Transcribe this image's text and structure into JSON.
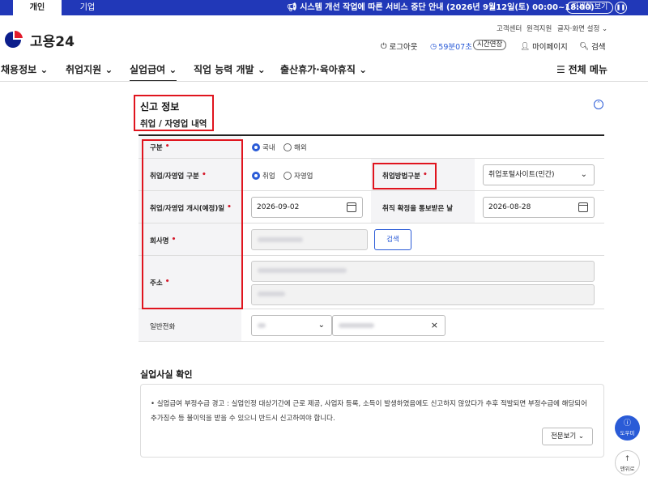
{
  "top_tabs": [
    "개인",
    "기업"
  ],
  "notice_bar": {
    "text": "시스템 개선 작업에 따른 서비스 중단 안내 (2026년 9월12일(토) 00:00~18:00)",
    "detail_button": "자세히 보기",
    "pause_icon": "pause-icon"
  },
  "utility_links": [
    "고객센터",
    "원격지원",
    "글자·화면 설정"
  ],
  "logo": {
    "text": "고용24"
  },
  "account": {
    "logout": "로그아웃",
    "timer": "59분07초",
    "extend": "시간연장",
    "mypage": "마이페이지",
    "search": "검색"
  },
  "gnb": {
    "items": [
      "채용정보",
      "취업지원",
      "실업급여",
      "직업 능력 개발",
      "출산휴가·육아휴직"
    ],
    "active": "실업급여",
    "all_menu": "전체 메뉴"
  },
  "section": {
    "title": "신고 정보",
    "subtitle": "취업 / 자영업 내역"
  },
  "form": {
    "type_label": "구분",
    "type_options": [
      "국내",
      "해외"
    ],
    "type_selected": "국내",
    "emp_type_label": "취업/자영업 구분",
    "emp_type_options": [
      "취업",
      "자영업"
    ],
    "emp_type_selected": "취업",
    "method_label": "취업방법구분",
    "method_value": "취업포털사이트(민간)",
    "start_label": "취업/자영업 개시(예정)일",
    "start_value": "2026-09-02",
    "notified_label": "취직 확정을 통보받은 날",
    "notified_value": "2026-08-28",
    "company_label": "회사명",
    "search_button": "검색",
    "address_label": "주소",
    "phone_label": "일반전화",
    "clear_icon": "×"
  },
  "confirm": {
    "title": "실업사실 확인",
    "text": "• 실업급여 부정수급 경고 : 실업인정 대상기간에 근로 제공, 사업자 등록, 소득이 발생하였음에도 신고하지 않았다가 추후 적발되면 부정수급에 해당되어 추가징수 등 불이익을 받을 수 있으니 반드시 신고하여야 합니다.",
    "full_view": "전문보기"
  },
  "floating": {
    "help": "도우미",
    "top": "맨위로"
  },
  "colors": {
    "brand": "#2138b8",
    "accent": "#2a5bd7",
    "required": "#d51a2c",
    "highlight": "#e0141e"
  }
}
